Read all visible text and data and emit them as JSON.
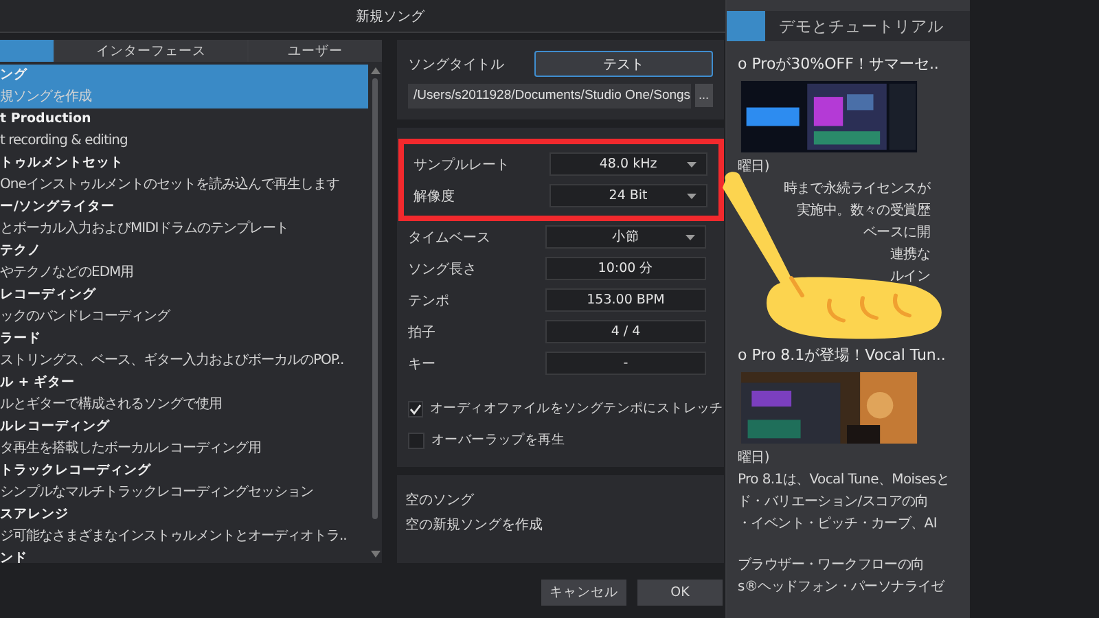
{
  "window": {
    "title": "新規ソング"
  },
  "tabs": [
    {
      "selected": true
    },
    {
      "label": "インターフェース",
      "selected": false
    },
    {
      "label": "ユーザー",
      "selected": false
    }
  ],
  "templates": [
    {
      "title": "ング",
      "description": "規ソングを作成",
      "selected": true
    },
    {
      "title": "t Production",
      "description": "t recording & editing",
      "selected": false
    },
    {
      "title": "トゥルメントセット",
      "description": "Oneインストゥルメントのセットを読み込んで再生します",
      "selected": false
    },
    {
      "title": "ー/ソングライター",
      "description": "とボーカル入力およびMIDIドラムのテンプレート",
      "selected": false
    },
    {
      "title": "テクノ",
      "description": "やテクノなどのEDM用",
      "selected": false
    },
    {
      "title": "レコーディング",
      "description": "ックのバンドレコーディング",
      "selected": false
    },
    {
      "title": "ラード",
      "description": "ストリングス、ベース、ギター入力およびボーカルのPOP..",
      "selected": false
    },
    {
      "title": "ル + ギター",
      "description": "ルとギターで構成されるソングで使用",
      "selected": false
    },
    {
      "title": "ルレコーディング",
      "description": "タ再生を搭載したボーカルレコーディング用",
      "selected": false
    },
    {
      "title": "トラックレコーディング",
      "description": "シンプルなマルチトラックレコーディングセッション",
      "selected": false
    },
    {
      "title": "スアレンジ",
      "description": "ジ可能なさまざまなインストゥルメントとオーディオトラ..",
      "selected": false
    },
    {
      "title": "ンド",
      "selected": false
    }
  ],
  "song": {
    "title_label": "ソングタイトル",
    "title_value": "テスト",
    "path": "/Users/s2011928/Documents/Studio One/Songs",
    "browse_button": "...",
    "fields": [
      {
        "label": "サンプルレート",
        "value": "48.0 kHz",
        "kind": "dropdown",
        "highlighted": true
      },
      {
        "label": "解像度",
        "value": "24 Bit",
        "kind": "dropdown",
        "highlighted": true
      },
      {
        "label": "タイムベース",
        "value": "小節",
        "kind": "dropdown",
        "highlighted": false
      },
      {
        "label": "ソング長さ",
        "value": "10:00 分",
        "kind": "field",
        "highlighted": false
      },
      {
        "label": "テンポ",
        "value": "153.00 BPM",
        "kind": "field",
        "highlighted": false
      },
      {
        "label": "拍子",
        "value": "4   /   4",
        "kind": "field",
        "highlighted": false
      },
      {
        "label": "キー",
        "value": "-",
        "kind": "field",
        "highlighted": false
      }
    ],
    "options": [
      {
        "label": "オーディオファイルをソングテンポにストレッチ",
        "checked": true
      },
      {
        "label": "オーバーラップを再生",
        "checked": false
      }
    ]
  },
  "description_panel": {
    "title": "空のソング",
    "text": "空の新規ソングを作成"
  },
  "buttons": [
    "キャンセル",
    "OK"
  ],
  "news_panel": {
    "tabs": [
      {
        "selected": true
      },
      {
        "label": "デモとチュートリアル",
        "selected": false
      }
    ],
    "items": [
      {
        "kind": "headline",
        "text": "o Proが30%OFF！サマーセ.."
      },
      {
        "kind": "picture"
      },
      {
        "kind": "text",
        "text": "曜日)"
      },
      {
        "kind": "partial",
        "text": "時まで永続ライセンスが"
      },
      {
        "kind": "partial",
        "text": "実施中。数々の受賞歴"
      },
      {
        "kind": "partial",
        "text": "ベースに開"
      },
      {
        "kind": "partial",
        "text": "連携な"
      },
      {
        "kind": "partial",
        "text": "ルイン"
      },
      {
        "kind": "gap"
      },
      {
        "kind": "headline",
        "text": "o Pro 8.1が登場！Vocal Tun.."
      },
      {
        "kind": "picture"
      },
      {
        "kind": "text",
        "text": "曜日)"
      },
      {
        "kind": "text",
        "text": "Pro 8.1は、Vocal Tune、Moisesと"
      },
      {
        "kind": "text",
        "text": "ド・バリエーション/スコアの向"
      },
      {
        "kind": "text",
        "text": "・イベント・ピッチ・カーブ、AI"
      },
      {
        "kind": "line_gap"
      },
      {
        "kind": "text",
        "text": "ブラウザー・ワークフローの向"
      },
      {
        "kind": "text",
        "text": "s®ヘッドフォン・パーソナライゼ"
      }
    ]
  }
}
